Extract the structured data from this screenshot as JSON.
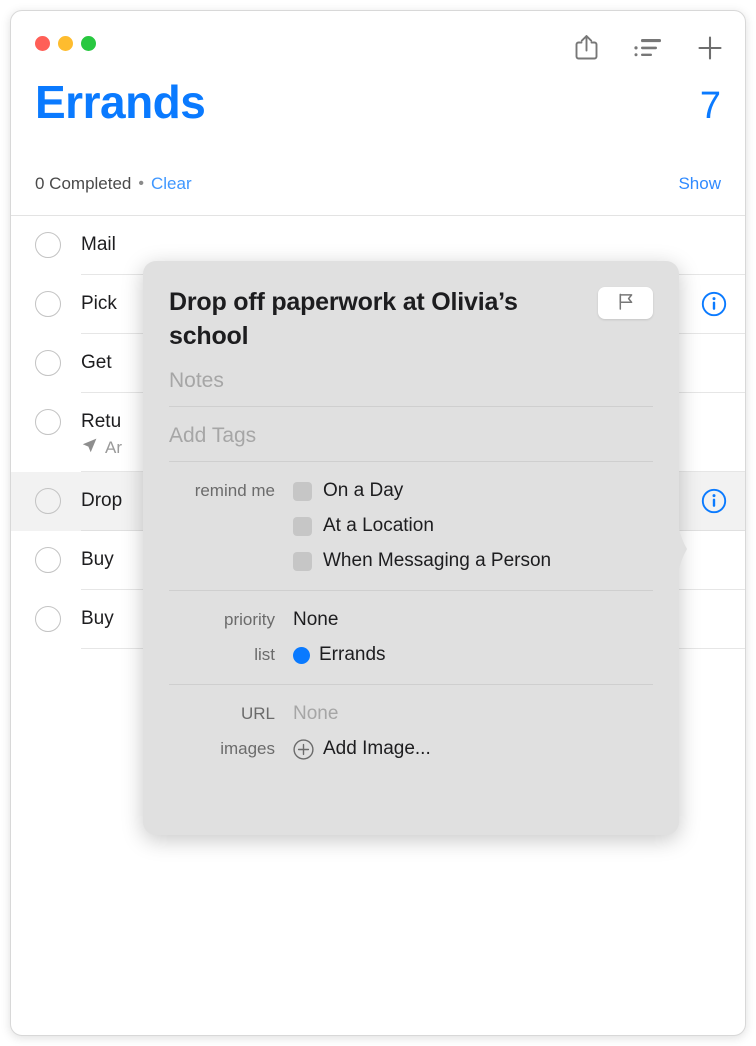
{
  "window": {
    "traffic_lights": [
      {
        "name": "close",
        "color": "#ff5f57"
      },
      {
        "name": "minimize",
        "color": "#febc2e"
      },
      {
        "name": "zoom",
        "color": "#28c840"
      }
    ],
    "toolbar": [
      {
        "name": "share-icon",
        "label": "Share"
      },
      {
        "name": "list-options-icon",
        "label": "View Options"
      },
      {
        "name": "add-icon",
        "label": "Add Reminder"
      }
    ]
  },
  "header": {
    "title": "Errands",
    "count": "7",
    "accent_color": "#0a7aff",
    "completed_text": "0 Completed",
    "separator": "•",
    "clear_label": "Clear",
    "show_label": "Show"
  },
  "reminders": [
    {
      "title": "Mail",
      "subtitle": "",
      "selected": false,
      "info": false
    },
    {
      "title": "Pick",
      "subtitle": "",
      "selected": false,
      "info": true
    },
    {
      "title": "Get ",
      "subtitle": "",
      "selected": false,
      "info": false
    },
    {
      "title": "Retu",
      "subtitle": "Ar",
      "subtitle_icon": "location-arrow-icon",
      "selected": false,
      "info": false
    },
    {
      "title": "Drop",
      "subtitle": "",
      "selected": true,
      "info": true
    },
    {
      "title": "Buy ",
      "subtitle": "",
      "selected": false,
      "info": false
    },
    {
      "title": "Buy ",
      "subtitle": "",
      "selected": false,
      "info": false
    }
  ],
  "popover": {
    "title": "Drop off paperwork at Olivia’s school",
    "flag_icon": "flag-icon",
    "notes_placeholder": "Notes",
    "tags_placeholder": "Add Tags",
    "remind_me": {
      "label": "remind me",
      "options": [
        {
          "label": "On a Day",
          "checked": false
        },
        {
          "label": "At a Location",
          "checked": false
        },
        {
          "label": "When Messaging a Person",
          "checked": false
        }
      ]
    },
    "priority": {
      "label": "priority",
      "value": "None"
    },
    "list": {
      "label": "list",
      "value": "Errands",
      "color": "#0a7aff"
    },
    "url": {
      "label": "URL",
      "value": "None"
    },
    "images": {
      "label": "images",
      "value": "Add Image...",
      "icon": "plus-circle-icon"
    }
  }
}
